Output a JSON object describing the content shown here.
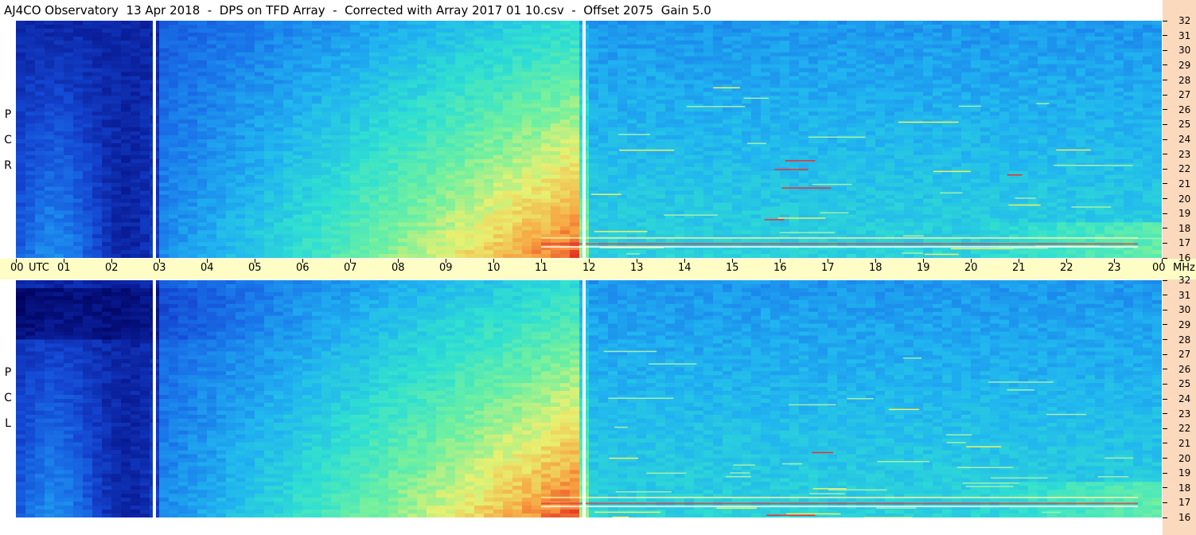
{
  "title": "AJ4CO Observatory  13 Apr 2018  -  DPS on TFD Array  -  Corrected with Array 2017 01 10.csv  -  Offset 2075  Gain 5.0",
  "chart_data": {
    "type": "heatmap",
    "panels": [
      {
        "name": "RCP",
        "label_letters": [
          "P",
          "C",
          "R"
        ]
      },
      {
        "name": "LCP",
        "label_letters": [
          "P",
          "C",
          "L"
        ]
      }
    ],
    "x_axis": {
      "unit_label": "UTC",
      "tick_labels": [
        "00",
        "01",
        "02",
        "03",
        "04",
        "05",
        "06",
        "07",
        "08",
        "09",
        "10",
        "11",
        "12",
        "13",
        "14",
        "15",
        "16",
        "17",
        "18",
        "19",
        "20",
        "21",
        "22",
        "23",
        "00"
      ],
      "range_hours": [
        0,
        24
      ]
    },
    "y_axis": {
      "unit_label": "MHz",
      "tick_labels": [
        "32",
        "31",
        "30",
        "29",
        "28",
        "27",
        "26",
        "25",
        "24",
        "23",
        "22",
        "21",
        "20",
        "19",
        "18",
        "17",
        "16"
      ],
      "range_mhz": [
        16,
        32
      ]
    },
    "data_gaps_utc": [
      2.9,
      11.9
    ],
    "colormap": [
      "#00005a",
      "#0a1e9a",
      "#1446d2",
      "#1a78ea",
      "#20b4f0",
      "#30e0d0",
      "#70f0a0",
      "#e8f070",
      "#f8a040",
      "#e02020",
      "#ffffff"
    ]
  }
}
